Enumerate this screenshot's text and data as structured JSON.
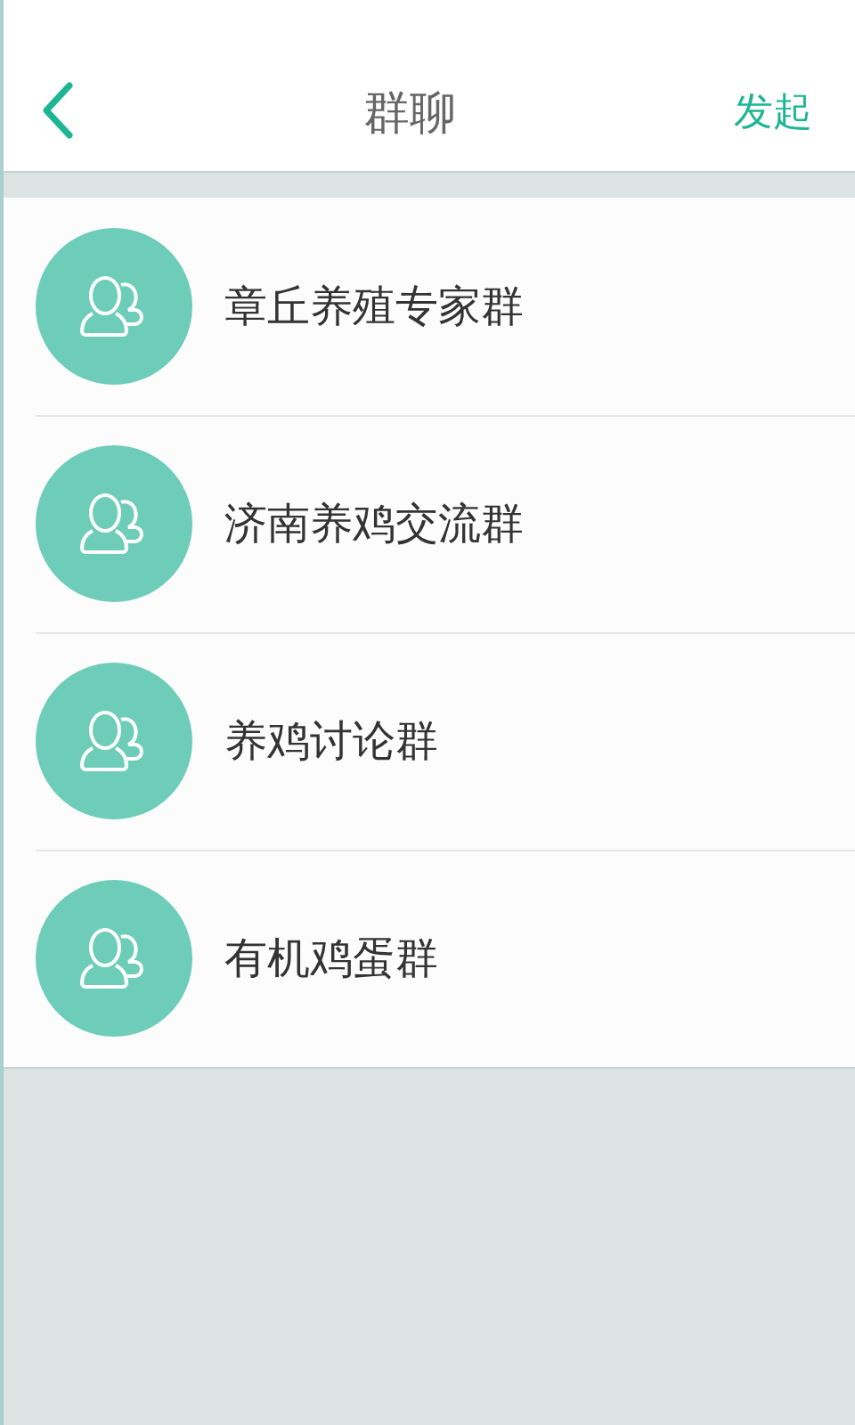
{
  "header": {
    "title": "群聊",
    "action": "发起"
  },
  "groups": [
    {
      "name": "章丘养殖专家群"
    },
    {
      "name": "济南养鸡交流群"
    },
    {
      "name": "养鸡讨论群"
    },
    {
      "name": "有机鸡蛋群"
    }
  ]
}
